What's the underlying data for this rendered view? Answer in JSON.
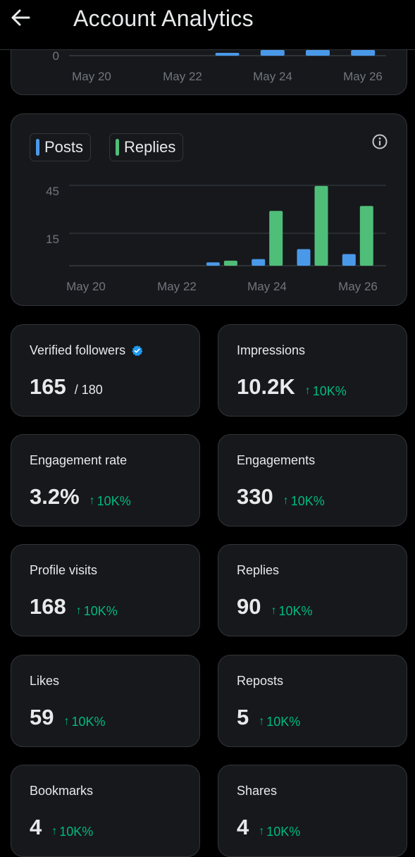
{
  "header": {
    "title": "Account Analytics"
  },
  "top_chart": {
    "y_zero_label": "0",
    "x_labels": [
      "May 20",
      "May 22",
      "May 24",
      "May 26"
    ]
  },
  "posts_replies_chart": {
    "legend": {
      "posts": "Posts",
      "replies": "Replies"
    },
    "colors": {
      "posts": "#4a99e9",
      "replies": "#4fbe79",
      "grid": "#2f3336",
      "axis_text": "#71767b"
    },
    "y_labels": [
      "45",
      "15"
    ]
  },
  "chart_data": [
    {
      "type": "bar",
      "categories": [
        "May 20",
        "May 21",
        "May 22",
        "May 23",
        "May 24",
        "May 25",
        "May 26"
      ],
      "values": [
        0,
        0,
        0,
        1,
        2,
        2,
        2
      ],
      "xlabel": "",
      "ylabel": "",
      "x_tick_labels": [
        "May 20",
        "May 22",
        "May 24",
        "May 26"
      ],
      "y_tick_labels": [
        "0"
      ],
      "grid": true
    },
    {
      "type": "bar",
      "categories": [
        "May 20",
        "May 21",
        "May 22",
        "May 23",
        "May 24",
        "May 25",
        "May 26"
      ],
      "series": [
        {
          "name": "Posts",
          "values": [
            0,
            0,
            0,
            2,
            4,
            10,
            7
          ]
        },
        {
          "name": "Replies",
          "values": [
            0,
            0,
            0,
            3,
            33,
            48,
            36
          ]
        }
      ],
      "x_tick_labels": [
        "May 20",
        "May 22",
        "May 24",
        "May 26"
      ],
      "y_tick_labels": [
        "45",
        "15"
      ],
      "ylim": [
        0,
        50
      ],
      "grid": true,
      "legend": "top-left"
    }
  ],
  "stats": [
    {
      "label": "Verified followers",
      "value": "165",
      "sub": "/ 180",
      "verified": true
    },
    {
      "label": "Impressions",
      "value": "10.2K",
      "change": "10K%"
    },
    {
      "label": "Engagement rate",
      "value": "3.2%",
      "change": "10K%"
    },
    {
      "label": "Engagements",
      "value": "330",
      "change": "10K%"
    },
    {
      "label": "Profile visits",
      "value": "168",
      "change": "10K%"
    },
    {
      "label": "Replies",
      "value": "90",
      "change": "10K%"
    },
    {
      "label": "Likes",
      "value": "59",
      "change": "10K%"
    },
    {
      "label": "Reposts",
      "value": "5",
      "change": "10K%"
    },
    {
      "label": "Bookmarks",
      "value": "4",
      "change": "10K%"
    },
    {
      "label": "Shares",
      "value": "4",
      "change": "10K%"
    }
  ]
}
